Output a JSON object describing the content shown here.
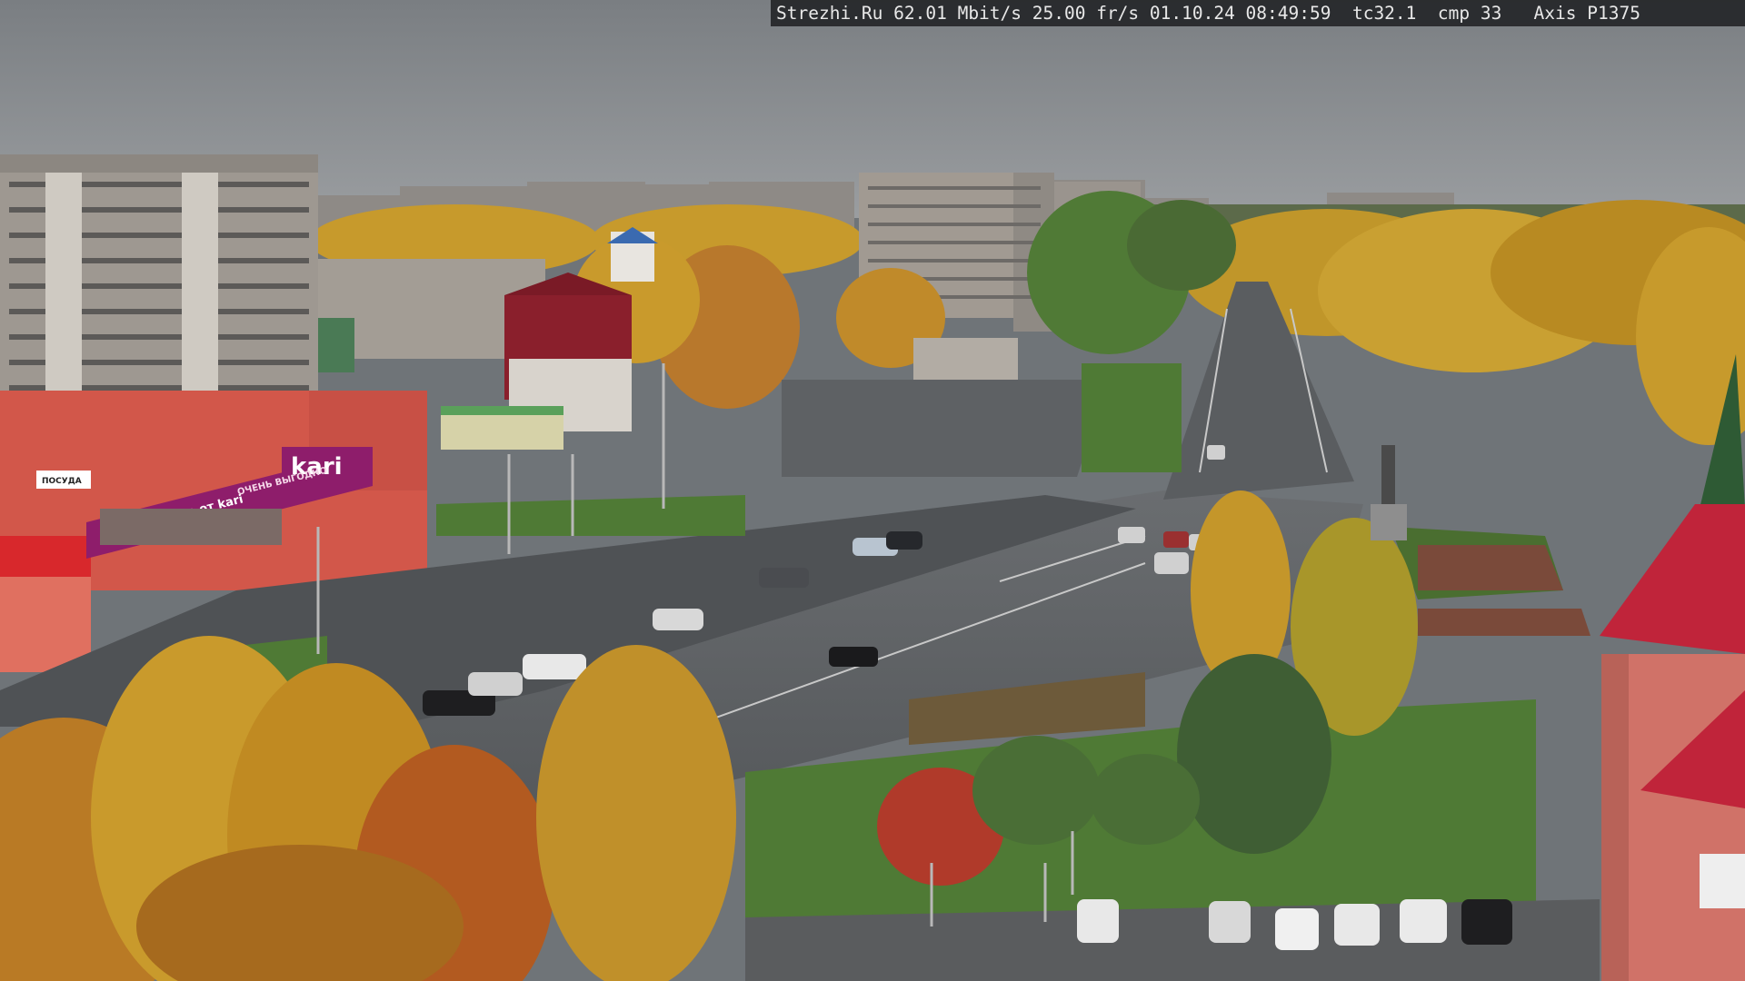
{
  "overlay": {
    "text": "Strezhi.Ru 62.01 Mbit/s 25.00 fr/s 01.10.24 08:49:59  tc32.1  cmp 33   Axis P1375"
  },
  "signs": {
    "store_logo": "kari",
    "store_slogan": "счастье от kari",
    "store_banner": "ОЧЕНЬ ВЫГОДНО",
    "shop_sign_left": "ПОСУДА"
  },
  "colors": {
    "sky": "#8a8d91",
    "foliage_yellow": "#c99a2a",
    "foliage_orange": "#b8702a",
    "asphalt": "#55585b",
    "grass": "#4f7a35",
    "building_gray": "#9a958f",
    "store_red": "#d2574a",
    "kari_magenta": "#8e1d6b",
    "roof_red": "#c0243a"
  }
}
